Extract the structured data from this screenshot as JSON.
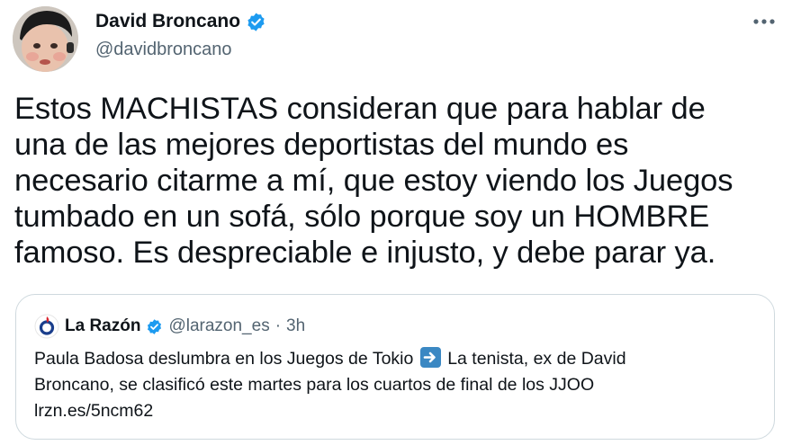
{
  "author": {
    "name": "David Broncano",
    "handle": "@davidbroncano",
    "verified": true
  },
  "tweet": {
    "lines": [
      "Estos MACHISTAS consideran que para hablar de",
      "una de las mejores deportistas del mundo es",
      "necesario citarme a mí, que estoy viendo los Juegos",
      "tumbado en un sofá, sólo porque soy un HOMBRE",
      "famoso. Es despreciable e injusto, y debe parar ya."
    ]
  },
  "quoted_tweet": {
    "name": "La Razón",
    "handle": "@larazon_es",
    "separator": "·",
    "time": "3h",
    "line1_before_arrow": "Paula Badosa deslumbra en los Juegos de Tokio",
    "line1_after_arrow": "La tenista, ex de David",
    "line2": "Broncano, se clasificó este martes para los cuartos de final de los JJOO",
    "link": "lrzn.es/5ncm62"
  },
  "colors": {
    "verified_blue": "#1d9bf0",
    "secondary_text": "#536471",
    "border": "#cfd9de",
    "arrow_emoji": "#3b88c3",
    "larazon_red": "#d9232d"
  },
  "icons": {
    "more": "more-dots-icon",
    "verified": "verified-badge-icon",
    "arrow": "right-arrow-emoji-icon"
  }
}
